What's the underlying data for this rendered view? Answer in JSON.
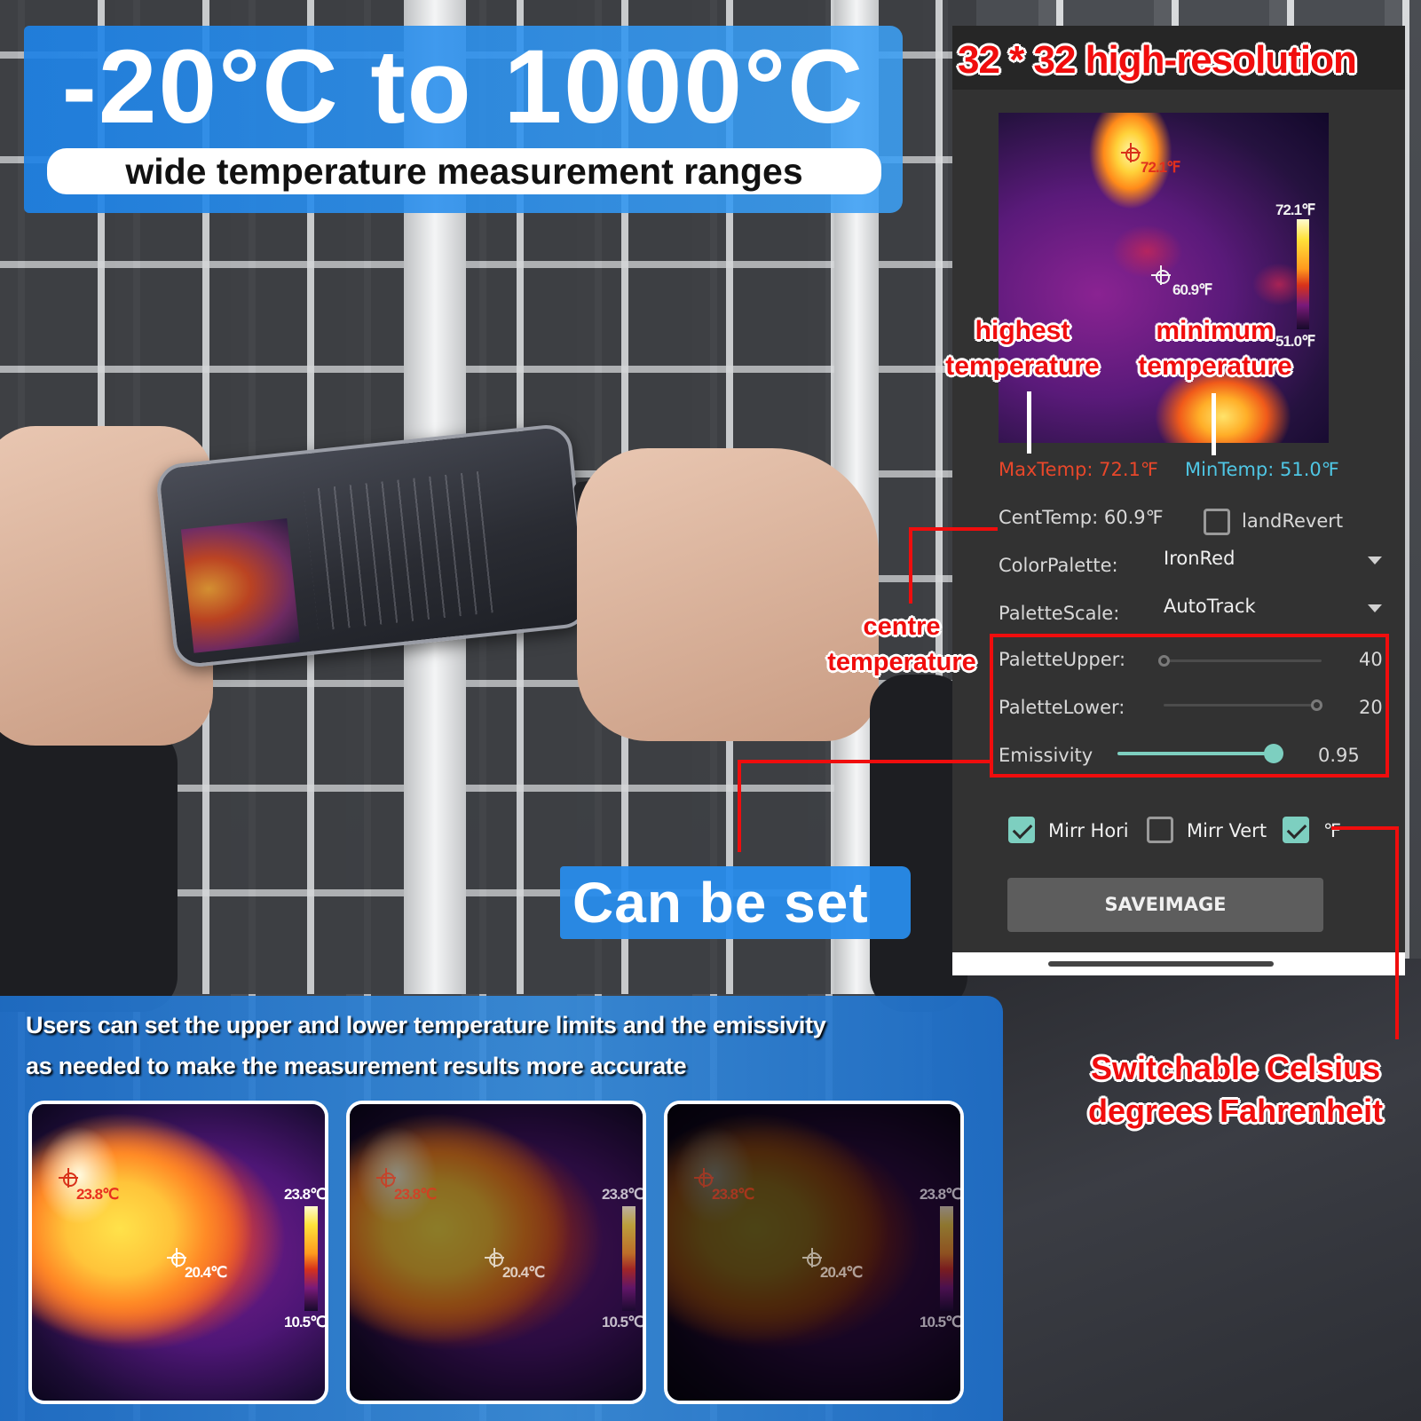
{
  "banner": {
    "title": "-20°C to 1000°C",
    "subtitle": "wide temperature measurement ranges"
  },
  "app": {
    "resolution_title": "32 * 32 high-resolution",
    "thermal_view": {
      "max_marker_label": "72.1℉",
      "center_marker_label": "60.9℉",
      "scale_max_label": "72.1℉",
      "scale_min_label": "51.0℉"
    },
    "max_temp": "MaxTemp: 72.1℉",
    "min_temp": "MinTemp: 51.0℉",
    "cent_temp": "CentTemp: 60.9℉",
    "land_revert": {
      "label": "landRevert",
      "checked": false
    },
    "color_palette": {
      "label": "ColorPalette:",
      "value": "IronRed"
    },
    "palette_scale": {
      "label": "PaletteScale:",
      "value": "AutoTrack"
    },
    "palette_upper": {
      "label": "PaletteUpper:",
      "value": "40",
      "position": 0.0
    },
    "palette_lower": {
      "label": "PaletteLower:",
      "value": "20",
      "position": 1.0
    },
    "emissivity": {
      "label": "Emissivity",
      "value": "0.95",
      "position": 0.95
    },
    "mirr_hori": {
      "label": "Mirr Hori",
      "checked": true
    },
    "mirr_vert": {
      "label": "Mirr Vert",
      "checked": false
    },
    "fahrenheit": {
      "label": "℉",
      "checked": true
    },
    "save_button": "SAVEIMAGE"
  },
  "annotations": {
    "highest": [
      "highest",
      "temperature"
    ],
    "minimum": [
      "minimum",
      "temperature"
    ],
    "centre": [
      "centre",
      "temperature"
    ],
    "can_be_set": "Can be set",
    "switchable": [
      "Switchable Celsius",
      "degrees Fahrenheit"
    ]
  },
  "bottom": {
    "line1": "Users can set the upper and lower temperature limits and the emissivity",
    "line2": "as needed to make the measurement results more accurate",
    "samples": [
      {
        "hot_label": "23.8℃",
        "center_label": "20.4℃",
        "scale_max": "23.8℃",
        "scale_min": "10.5℃",
        "dim": 0.0
      },
      {
        "hot_label": "23.8℃",
        "center_label": "20.4℃",
        "scale_max": "23.8℃",
        "scale_min": "10.5℃",
        "dim": 0.45
      },
      {
        "hot_label": "23.8℃",
        "center_label": "20.4℃",
        "scale_max": "23.8℃",
        "scale_min": "10.5℃",
        "dim": 0.7
      }
    ]
  },
  "colors": {
    "accent_blue": "#2a8ee8",
    "annotation_red": "#f00d0d",
    "max_temp": "#e8472a",
    "min_temp": "#4fc6e4",
    "toggle_teal": "#7dcfc0",
    "app_bg": "#323232"
  }
}
